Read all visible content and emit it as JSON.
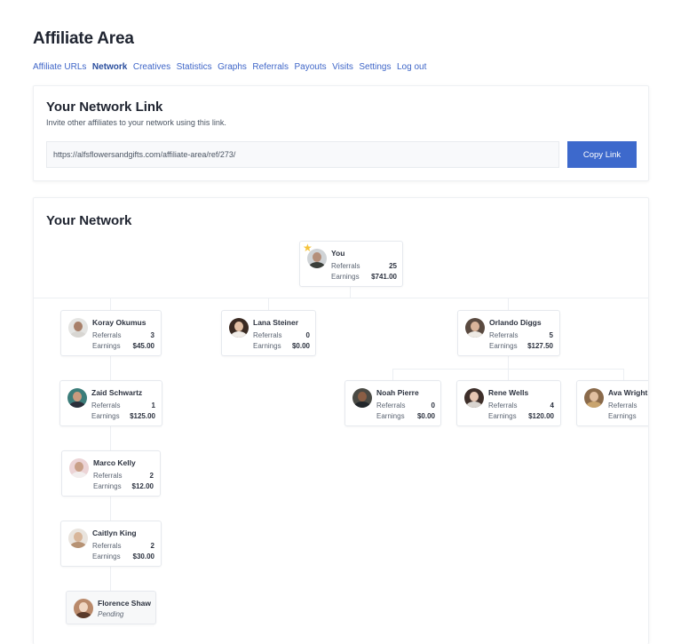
{
  "page_title": "Affiliate Area",
  "nav": [
    {
      "label": "Affiliate URLs",
      "active": false
    },
    {
      "label": "Network",
      "active": true
    },
    {
      "label": "Creatives",
      "active": false
    },
    {
      "label": "Statistics",
      "active": false
    },
    {
      "label": "Graphs",
      "active": false
    },
    {
      "label": "Referrals",
      "active": false
    },
    {
      "label": "Payouts",
      "active": false
    },
    {
      "label": "Visits",
      "active": false
    },
    {
      "label": "Settings",
      "active": false
    },
    {
      "label": "Log out",
      "active": false
    }
  ],
  "network_link": {
    "title": "Your Network Link",
    "subtitle": "Invite other affiliates to your network using this link.",
    "url": "https://alfsflowersandgifts.com/affiliate-area/ref/273/",
    "copy_label": "Copy Link"
  },
  "network": {
    "title": "Your Network",
    "labels": {
      "referrals": "Referrals",
      "earnings": "Earnings",
      "pending": "Pending"
    },
    "nodes": {
      "you": {
        "name": "You",
        "referrals": "25",
        "earnings": "$741.00",
        "starred": true
      },
      "koray": {
        "name": "Koray Okumus",
        "referrals": "3",
        "earnings": "$45.00"
      },
      "lana": {
        "name": "Lana Steiner",
        "referrals": "0",
        "earnings": "$0.00"
      },
      "orlando": {
        "name": "Orlando Diggs",
        "referrals": "5",
        "earnings": "$127.50"
      },
      "zaid": {
        "name": "Zaid Schwartz",
        "referrals": "1",
        "earnings": "$125.00"
      },
      "noah": {
        "name": "Noah Pierre",
        "referrals": "0",
        "earnings": "$0.00"
      },
      "rene": {
        "name": "Rene Wells",
        "referrals": "4",
        "earnings": "$120.00"
      },
      "ava": {
        "name": "Ava Wright",
        "referrals": "",
        "earnings": "$"
      },
      "marco": {
        "name": "Marco Kelly",
        "referrals": "2",
        "earnings": "$12.00"
      },
      "caitlyn": {
        "name": "Caitlyn King",
        "referrals": "2",
        "earnings": "$30.00"
      },
      "florence": {
        "name": "Florence Shaw",
        "status": "Pending"
      }
    }
  },
  "colors": {
    "accent": "#3d69cc",
    "nav_link": "#3f66c8",
    "star": "#f5c33b"
  }
}
